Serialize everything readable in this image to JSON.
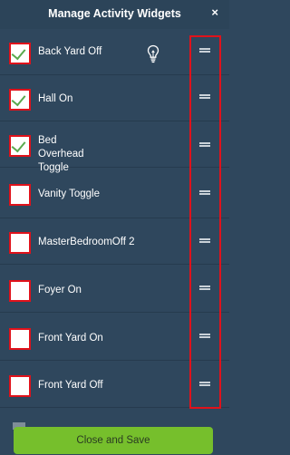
{
  "header": {
    "title": "Manage Activity Widgets",
    "close_label": "×"
  },
  "widgets": [
    {
      "label": "Back Yard Off",
      "checked": true,
      "icon": "lightbulb-icon"
    },
    {
      "label": "Hall On",
      "checked": true
    },
    {
      "label": "Bed Overhead Toggle",
      "checked": true
    },
    {
      "label": "Vanity Toggle",
      "checked": false
    },
    {
      "label": "MasterBedroomOff 2",
      "checked": false
    },
    {
      "label": "Foyer On",
      "checked": false
    },
    {
      "label": "Front Yard On",
      "checked": false
    },
    {
      "label": "Front Yard Off",
      "checked": false
    }
  ],
  "footer": {
    "save_label": "Close and Save"
  },
  "colors": {
    "background": "#2f475d",
    "accent_green": "#76bf2c",
    "highlight_red": "#e0121b",
    "check_green": "#5aa94d"
  }
}
